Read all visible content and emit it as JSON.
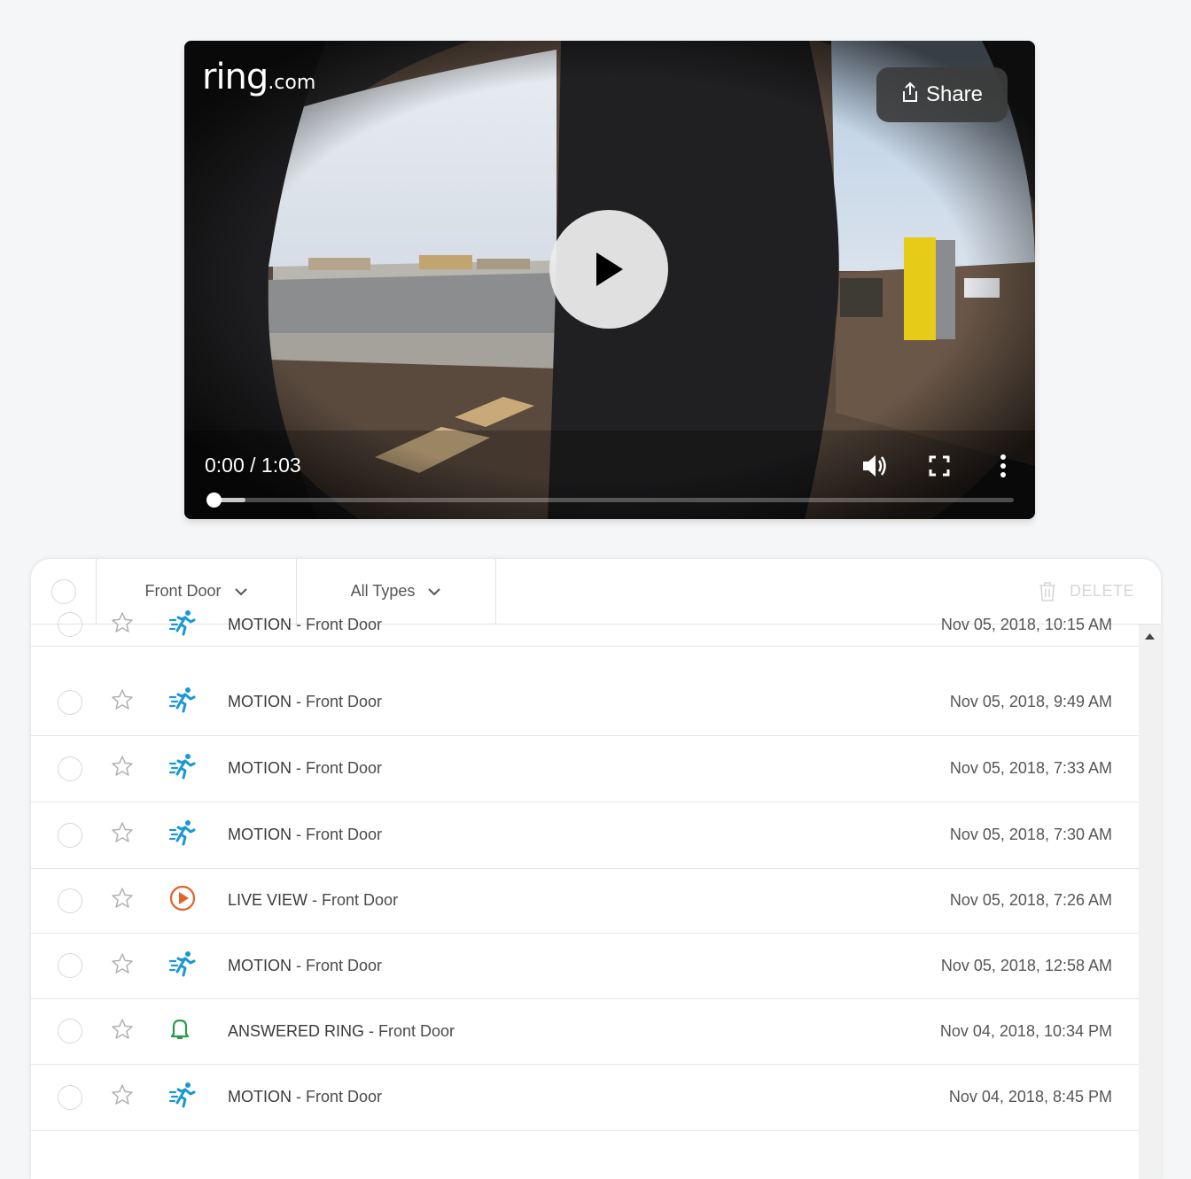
{
  "player": {
    "brand_main": "ring",
    "brand_sub": ".com",
    "share_label": "Share",
    "time_display": "0:00 / 1:03",
    "progress_fraction": 0.0,
    "buffer_fraction": 0.04
  },
  "toolbar": {
    "device_filter": "Front Door",
    "type_filter": "All Types",
    "delete_label": "DELETE"
  },
  "events": [
    {
      "kind": "MOTION",
      "device": "Front Door",
      "date": "Nov 05, 2018, 10:15 AM",
      "icon": "motion-icon"
    },
    {
      "kind": "MOTION",
      "device": "Front Door",
      "date": "Nov 05, 2018, 9:49 AM",
      "icon": "motion-icon"
    },
    {
      "kind": "MOTION",
      "device": "Front Door",
      "date": "Nov 05, 2018, 7:33 AM",
      "icon": "motion-icon"
    },
    {
      "kind": "MOTION",
      "device": "Front Door",
      "date": "Nov 05, 2018, 7:30 AM",
      "icon": "motion-icon"
    },
    {
      "kind": "LIVE VIEW",
      "device": "Front Door",
      "date": "Nov 05, 2018, 7:26 AM",
      "icon": "live-view-icon"
    },
    {
      "kind": "MOTION",
      "device": "Front Door",
      "date": "Nov 05, 2018, 12:58 AM",
      "icon": "motion-icon"
    },
    {
      "kind": "ANSWERED RING",
      "device": "Front Door",
      "date": "Nov 04, 2018, 10:34 PM",
      "icon": "bell-icon"
    },
    {
      "kind": "MOTION",
      "device": "Front Door",
      "date": "Nov 04, 2018, 8:45 PM",
      "icon": "motion-icon"
    }
  ],
  "colors": {
    "motion": "#1998d5",
    "live_view": "#e0622a",
    "ring": "#2a9a4a"
  }
}
